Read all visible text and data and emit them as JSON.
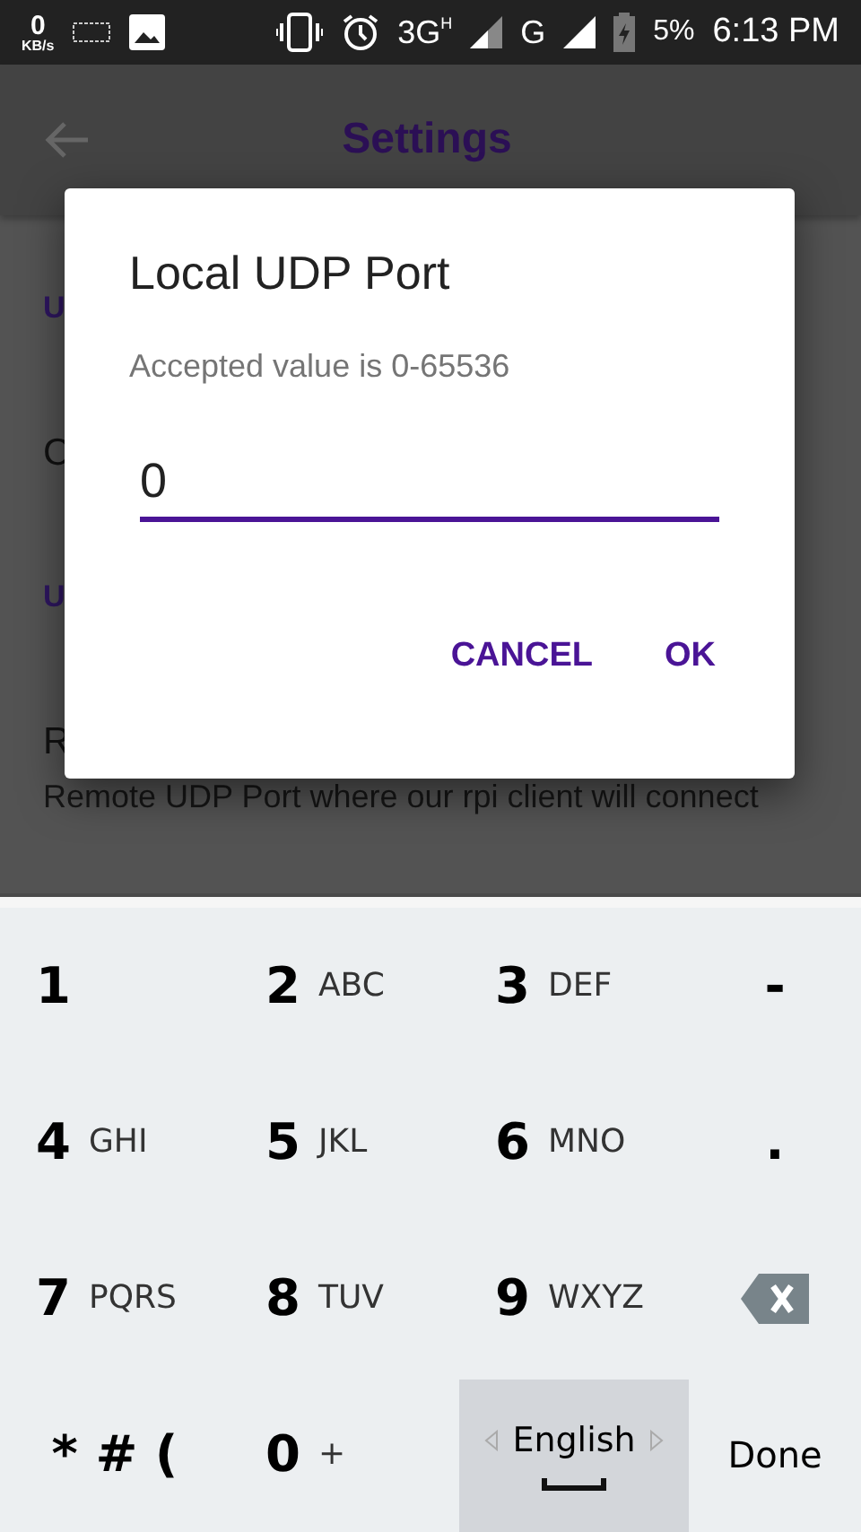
{
  "status_bar": {
    "speed": "0",
    "speed_unit": "KB/s",
    "network_1": "3G",
    "network_1_badge": "H",
    "network_2": "G",
    "battery": "5%",
    "time": "6:13 PM"
  },
  "app_bar": {
    "title": "Settings"
  },
  "background_items": [
    {
      "kind": "header",
      "text": "U"
    },
    {
      "kind": "title",
      "text": "C"
    },
    {
      "kind": "header",
      "text": "U"
    },
    {
      "kind": "title",
      "text": "R"
    },
    {
      "kind": "summary",
      "text": "Remote UDP Port where our rpi client will connect"
    }
  ],
  "dialog": {
    "title": "Local UDP Port",
    "message": "Accepted value is 0-65536",
    "value": "0",
    "buttons": [
      "CANCEL",
      "OK"
    ]
  },
  "keyboard": {
    "rows": [
      [
        {
          "kind": "digit",
          "main": "1"
        },
        {
          "kind": "digit",
          "main": "2",
          "sub": "ABC"
        },
        {
          "kind": "digit",
          "main": "3",
          "sub": "DEF"
        },
        {
          "kind": "symbol",
          "main": "-"
        }
      ],
      [
        {
          "kind": "digit",
          "main": "4",
          "sub": "GHI"
        },
        {
          "kind": "digit",
          "main": "5",
          "sub": "JKL"
        },
        {
          "kind": "digit",
          "main": "6",
          "sub": "MNO"
        },
        {
          "kind": "symbol",
          "main": "."
        }
      ],
      [
        {
          "kind": "digit",
          "main": "7",
          "sub": "PQRS"
        },
        {
          "kind": "digit",
          "main": "8",
          "sub": "TUV"
        },
        {
          "kind": "digit",
          "main": "9",
          "sub": "WXYZ"
        },
        {
          "kind": "backspace"
        }
      ],
      [
        {
          "kind": "symbol",
          "main": "* # ("
        },
        {
          "kind": "digit",
          "main": "0",
          "sub": "+"
        },
        {
          "kind": "space",
          "main": "English"
        },
        {
          "kind": "action",
          "main": "Done"
        }
      ]
    ]
  }
}
